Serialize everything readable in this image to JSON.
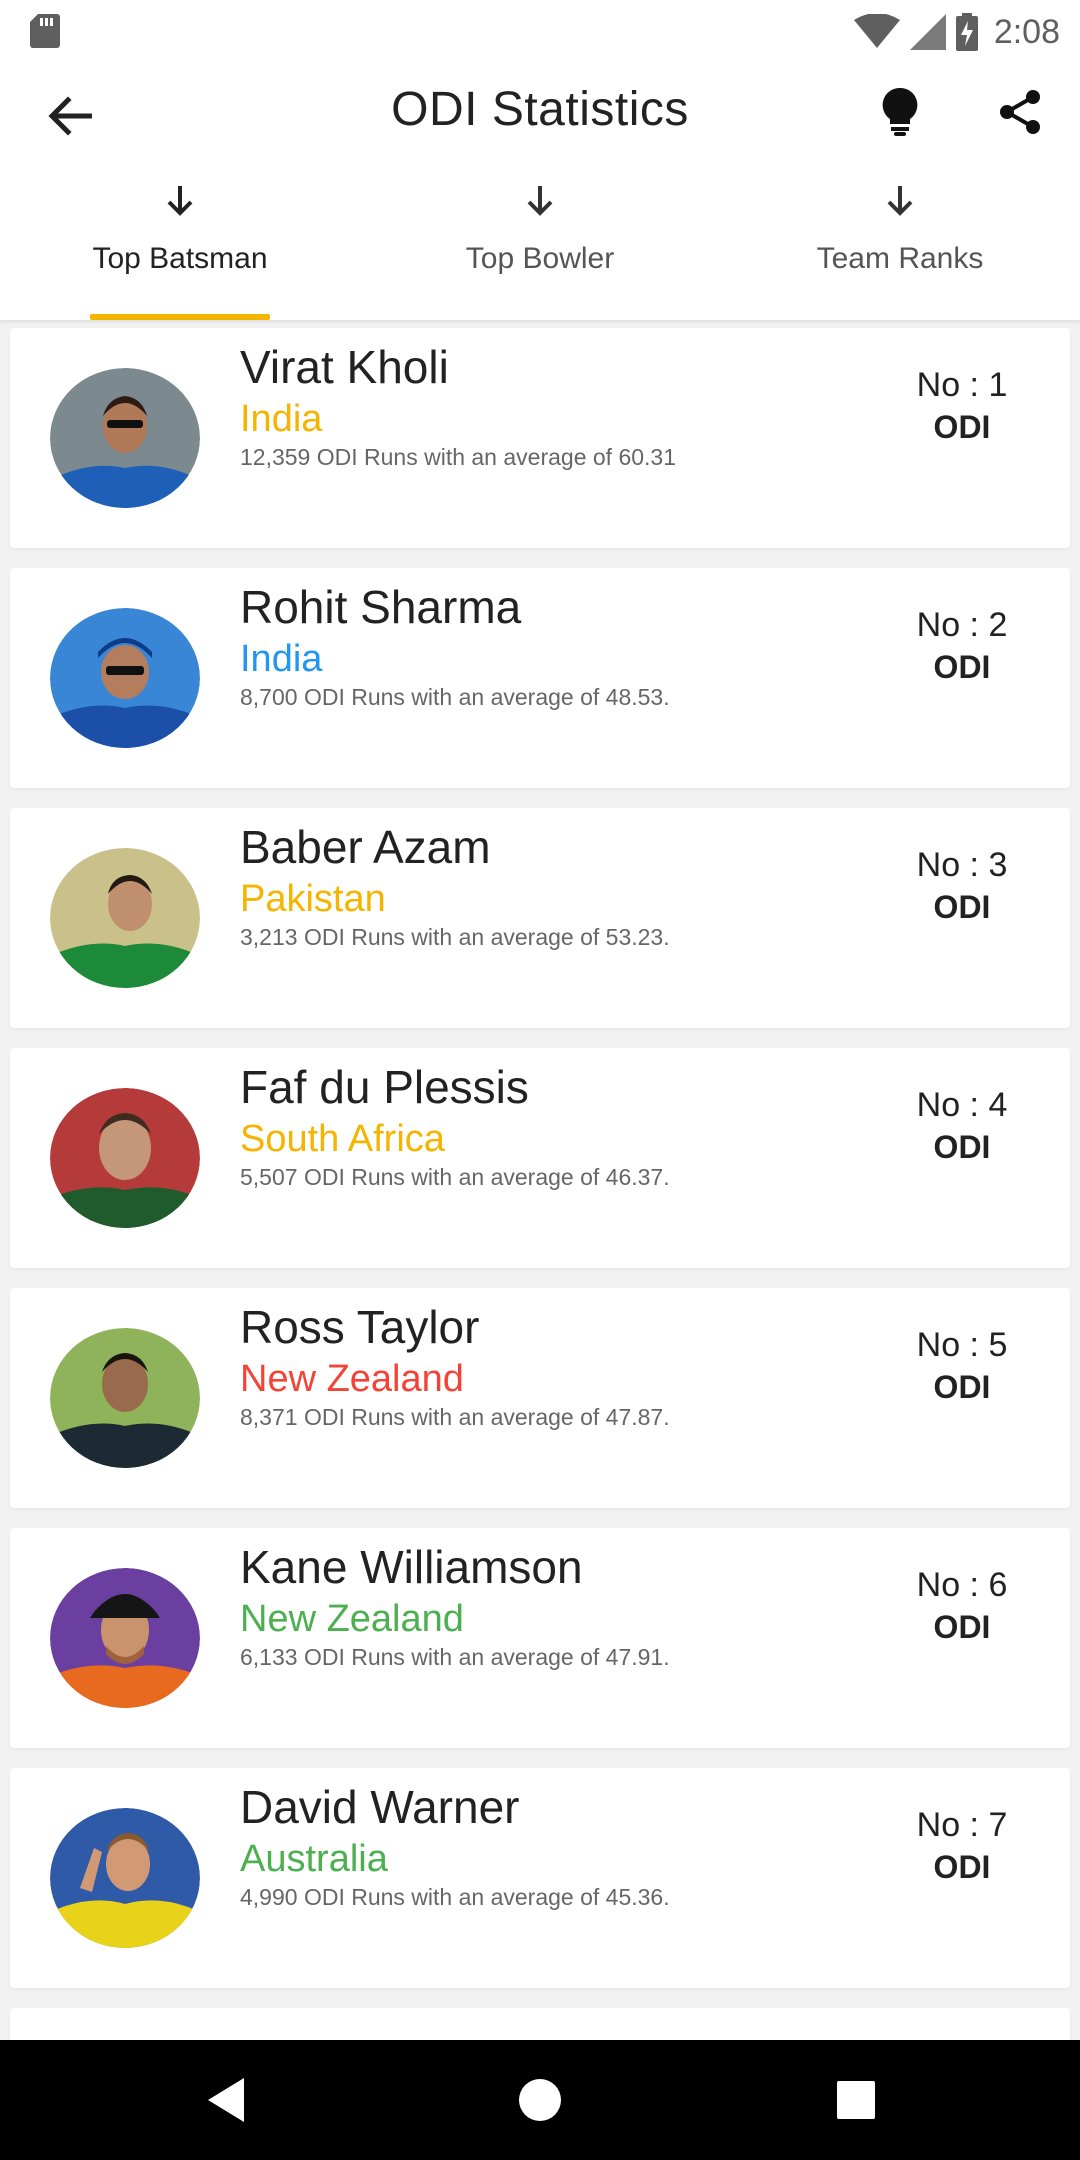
{
  "status_bar": {
    "time": "2:08",
    "icons": [
      "sd-card-icon",
      "wifi-icon",
      "cell-signal-icon",
      "battery-charging-icon"
    ]
  },
  "app_bar": {
    "title": "ODI Statistics",
    "icons": [
      "back-arrow-icon",
      "lightbulb-icon",
      "share-icon"
    ]
  },
  "tabs": [
    {
      "label": "Top Batsman",
      "active": true
    },
    {
      "label": "Top Bowler",
      "active": false
    },
    {
      "label": "Team Ranks",
      "active": false
    }
  ],
  "colors": {
    "accent": "#f4b400",
    "india_1": "#f4b400",
    "india_2": "#2196f3",
    "pakistan": "#f4b400",
    "south_africa": "#f4b400",
    "new_zealand_1": "#f44336",
    "new_zealand_2": "#4caf50",
    "australia": "#4caf50"
  },
  "players": [
    {
      "name": "Virat Kholi",
      "country": "India",
      "country_color": "#f4b400",
      "stats": "12,359 ODI Runs with an average of 60.31",
      "rank": "No : 1",
      "format": "ODI"
    },
    {
      "name": "Rohit Sharma",
      "country": "India",
      "country_color": "#2196f3",
      "stats": "8,700 ODI Runs with an average of 48.53.",
      "rank": "No : 2",
      "format": "ODI"
    },
    {
      "name": "Baber Azam",
      "country": "Pakistan",
      "country_color": "#f4b400",
      "stats": "3,213 ODI Runs with an average of 53.23.",
      "rank": "No : 3",
      "format": "ODI"
    },
    {
      "name": "Faf du Plessis",
      "country": "South Africa",
      "country_color": "#f4b400",
      "stats": "5,507 ODI Runs with an average of 46.37.",
      "rank": "No : 4",
      "format": "ODI"
    },
    {
      "name": "Ross Taylor",
      "country": "New Zealand",
      "country_color": "#f44336",
      "stats": "8,371 ODI Runs with an average of 47.87.",
      "rank": "No : 5",
      "format": "ODI"
    },
    {
      "name": "Kane Williamson",
      "country": "New Zealand",
      "country_color": "#4caf50",
      "stats": "6,133 ODI Runs with an average of 47.91.",
      "rank": "No : 6",
      "format": "ODI"
    },
    {
      "name": "David Warner",
      "country": "Australia",
      "country_color": "#4caf50",
      "stats": "4,990 ODI Runs with an average of 45.36.",
      "rank": "No : 7",
      "format": "ODI"
    }
  ],
  "nav_bar": {
    "icons": [
      "nav-back-icon",
      "nav-home-icon",
      "nav-recents-icon"
    ]
  }
}
